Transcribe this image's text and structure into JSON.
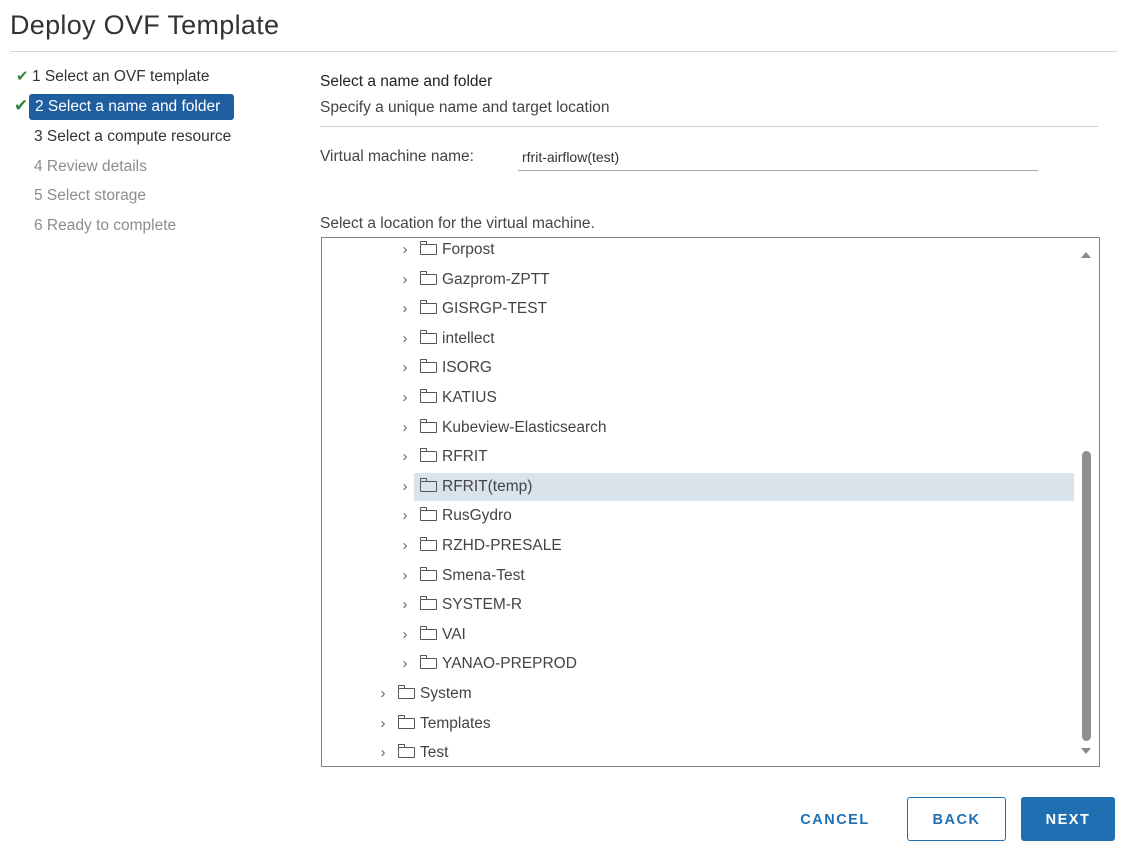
{
  "dialog": {
    "title": "Deploy OVF Template"
  },
  "steps": [
    {
      "label": "1 Select an OVF template",
      "status": "completed"
    },
    {
      "label": "2 Select a name and folder",
      "status": "active"
    },
    {
      "label": "3 Select a compute resource",
      "status": "enabled"
    },
    {
      "label": "4 Review details",
      "status": "disabled"
    },
    {
      "label": "5 Select storage",
      "status": "disabled"
    },
    {
      "label": "6 Ready to complete",
      "status": "disabled"
    }
  ],
  "main": {
    "title": "Select a name and folder",
    "subtitle": "Specify a unique name and target location",
    "vm_name_label": "Virtual machine name:",
    "vm_name_value": "rfrit-airflow(test)",
    "location_label": "Select a location for the virtual machine."
  },
  "tree": {
    "items": [
      {
        "label": "Forpost",
        "level": 2
      },
      {
        "label": "Gazprom-ZPTT",
        "level": 2
      },
      {
        "label": "GISRGP-TEST",
        "level": 2
      },
      {
        "label": "intellect",
        "level": 2
      },
      {
        "label": "ISORG",
        "level": 2
      },
      {
        "label": "KATIUS",
        "level": 2
      },
      {
        "label": "Kubeview-Elasticsearch",
        "level": 2
      },
      {
        "label": "RFRIT",
        "level": 2
      },
      {
        "label": "RFRIT(temp)",
        "level": 2,
        "selected": true
      },
      {
        "label": "RusGydro",
        "level": 2
      },
      {
        "label": "RZHD-PRESALE",
        "level": 2
      },
      {
        "label": "Smena-Test",
        "level": 2
      },
      {
        "label": "SYSTEM-R",
        "level": 2
      },
      {
        "label": "VAI",
        "level": 2
      },
      {
        "label": "YANAO-PREPROD",
        "level": 2
      },
      {
        "label": "System",
        "level": 1
      },
      {
        "label": "Templates",
        "level": 1
      },
      {
        "label": "Test",
        "level": 1
      }
    ],
    "icons": {
      "expand": "chevron-right-icon",
      "folder": "folder-icon"
    }
  },
  "footer": {
    "cancel_label": "CANCEL",
    "back_label": "BACK",
    "next_label": "NEXT"
  },
  "colors": {
    "accent": "#1f6fb2",
    "active_step": "#1f5e9f",
    "check": "#2e8540",
    "selected_row": "#d9e3ec"
  }
}
